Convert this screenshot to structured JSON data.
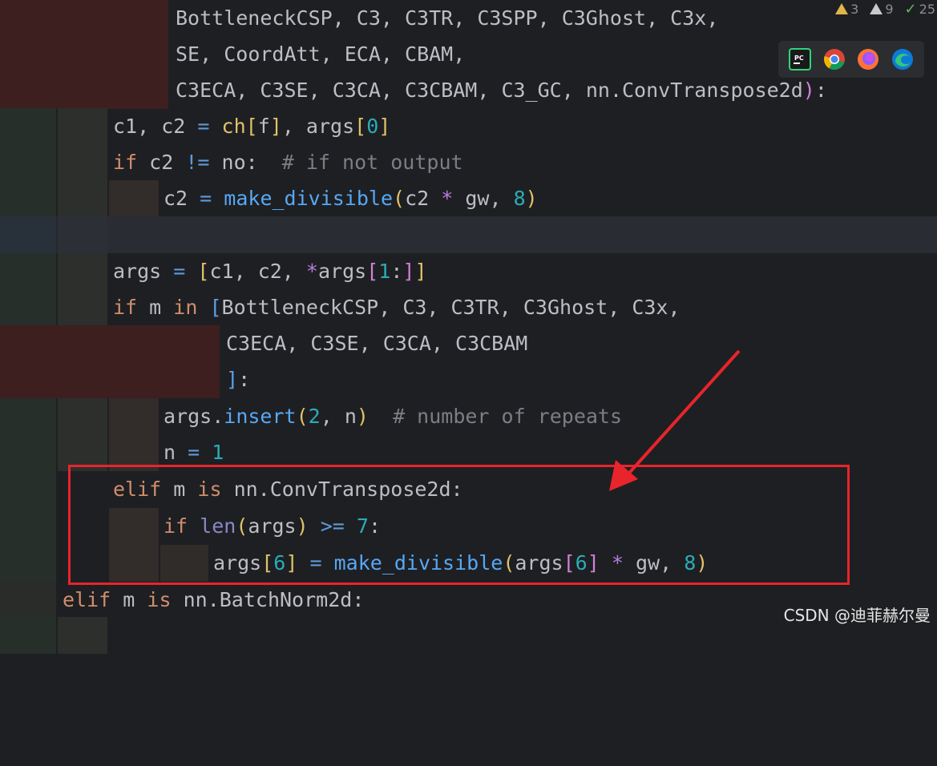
{
  "inspection": {
    "warnings": "3",
    "weak_warnings": "9",
    "typos": "25"
  },
  "browser_icons": [
    "pycharm-icon",
    "chrome-icon",
    "firefox-icon",
    "edge-icon"
  ],
  "code": {
    "l1": {
      "a": "BottleneckCSP",
      "b": "C3",
      "c": "C3TR",
      "d": "C3SPP",
      "e": "C3Ghost",
      "f": "C3x"
    },
    "l2": {
      "a": "SE",
      "b": "CoordAtt",
      "c": "ECA",
      "d": "CBAM"
    },
    "l3": {
      "a": "C3ECA",
      "b": "C3SE",
      "c": "C3CA",
      "d": "C3CBAM",
      "e": "C3_GC",
      "f": "nn",
      "g": "ConvTranspose2d"
    },
    "l4": {
      "a": "c1",
      "b": "c2",
      "c": "ch",
      "d": "f",
      "e": "args",
      "f": "0"
    },
    "l5": {
      "kw": "if",
      "a": "c2",
      "op": "!=",
      "b": "no",
      "cm": "# if not output"
    },
    "l6": {
      "a": "c2",
      "fn": "make_divisible",
      "b": "c2",
      "c": "gw",
      "d": "8"
    },
    "l8": {
      "a": "args",
      "b": "c1",
      "c": "c2",
      "d": "args",
      "e": "1"
    },
    "l9": {
      "kw": "if",
      "a": "m",
      "kw2": "in",
      "b": "BottleneckCSP",
      "c": "C3",
      "d": "C3TR",
      "e": "C3Ghost",
      "f": "C3x"
    },
    "l10": {
      "a": "C3ECA",
      "b": "C3SE",
      "c": "C3CA",
      "d": "C3CBAM"
    },
    "l12": {
      "a": "args",
      "fn": "insert",
      "b": "2",
      "c": "n",
      "cm": "# number of repeats"
    },
    "l13": {
      "a": "n",
      "b": "1"
    },
    "l14": {
      "kw": "elif",
      "a": "m",
      "kw2": "is",
      "b": "nn",
      "c": "ConvTranspose2d"
    },
    "l15": {
      "kw": "if",
      "bi": "len",
      "a": "args",
      "op": ">=",
      "b": "7"
    },
    "l16": {
      "a": "args",
      "b": "6",
      "fn": "make_divisible",
      "c": "args",
      "d": "6",
      "e": "gw",
      "f": "8"
    },
    "l17": {
      "kw": "elif",
      "a": "m",
      "kw2": "is",
      "b": "nn",
      "c": "BatchNorm2d"
    }
  },
  "watermark": "CSDN @迪菲赫尔曼",
  "colors": {
    "background": "#1e1f22",
    "keyword": "#cf8e6d",
    "function": "#56a8f5",
    "number": "#2aacb8",
    "comment": "#7a7e85",
    "highlight_box": "#e8242c"
  }
}
